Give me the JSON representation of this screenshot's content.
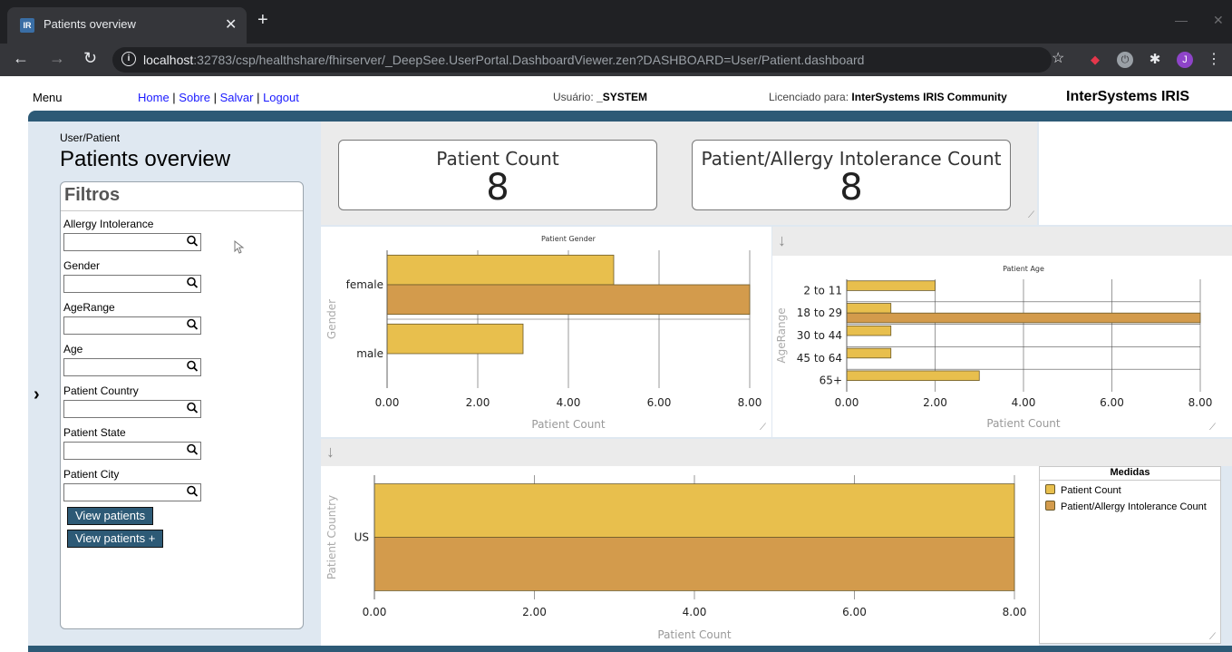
{
  "browser": {
    "tab_title": "Patients overview",
    "tab_favicon": "IR",
    "url_host": "localhost",
    "url_rest": ":32783/csp/healthshare/fhirserver/_DeepSee.UserPortal.DashboardViewer.zen?DASHBOARD=User/Patient.dashboard",
    "profile_initial": "J"
  },
  "header": {
    "menu": "Menu",
    "links": [
      "Home",
      "Sobre",
      "Salvar",
      "Logout"
    ],
    "user_label": "Usuário: ",
    "user_value": "_SYSTEM",
    "licensed_label": "Licenciado para: ",
    "licensed_value": "InterSystems IRIS Community",
    "brand": "InterSystems IRIS"
  },
  "left": {
    "breadcrumb": "User/Patient",
    "title": "Patients overview",
    "filters_title": "Filtros",
    "filters": [
      {
        "label": "Allergy Intolerance",
        "value": ""
      },
      {
        "label": "Gender",
        "value": ""
      },
      {
        "label": "AgeRange",
        "value": ""
      },
      {
        "label": "Age",
        "value": ""
      },
      {
        "label": "Patient Country",
        "value": ""
      },
      {
        "label": "Patient State",
        "value": ""
      },
      {
        "label": "Patient City",
        "value": ""
      }
    ],
    "buttons": [
      "View patients",
      "View patients +"
    ]
  },
  "kpis": [
    {
      "label": "Patient Count",
      "value": "8"
    },
    {
      "label": "Patient/Allergy Intolerance Count",
      "value": "8"
    }
  ],
  "colors": {
    "patient_count": "#e8bf4d",
    "allergy_count": "#d39b4c",
    "frame": "#2d5a76"
  },
  "legend": {
    "title": "Medidas",
    "items": [
      "Patient Count",
      "Patient/Allergy Intolerance Count"
    ]
  },
  "chart_data": [
    {
      "type": "bar",
      "orientation": "horizontal",
      "title": "Patient Gender",
      "xlabel": "Patient Count",
      "ylabel": "Gender",
      "xlim": [
        0,
        8
      ],
      "ticks": [
        "0.00",
        "2.00",
        "4.00",
        "6.00",
        "8.00"
      ],
      "categories": [
        "female",
        "male"
      ],
      "series": [
        {
          "name": "Patient Count",
          "values": [
            5,
            3
          ]
        },
        {
          "name": "Patient/Allergy Intolerance Count",
          "values": [
            8,
            0
          ]
        }
      ]
    },
    {
      "type": "bar",
      "orientation": "horizontal",
      "title": "Patient Age",
      "xlabel": "Patient Count",
      "ylabel": "AgeRange",
      "xlim": [
        0,
        8
      ],
      "ticks": [
        "0.00",
        "2.00",
        "4.00",
        "6.00",
        "8.00"
      ],
      "categories": [
        "2 to 11",
        "18 to 29",
        "30 to 44",
        "45 to 64",
        "65+"
      ],
      "series": [
        {
          "name": "Patient Count",
          "values": [
            2,
            1,
            1,
            1,
            3
          ]
        },
        {
          "name": "Patient/Allergy Intolerance Count",
          "values": [
            0,
            8,
            0,
            0,
            0
          ]
        }
      ]
    },
    {
      "type": "bar",
      "orientation": "horizontal",
      "title": "",
      "xlabel": "Patient Count",
      "ylabel": "Patient Country",
      "xlim": [
        0,
        8
      ],
      "ticks": [
        "0.00",
        "2.00",
        "4.00",
        "6.00",
        "8.00"
      ],
      "categories": [
        "US"
      ],
      "series": [
        {
          "name": "Patient Count",
          "values": [
            8
          ]
        },
        {
          "name": "Patient/Allergy Intolerance Count",
          "values": [
            8
          ]
        }
      ]
    }
  ]
}
